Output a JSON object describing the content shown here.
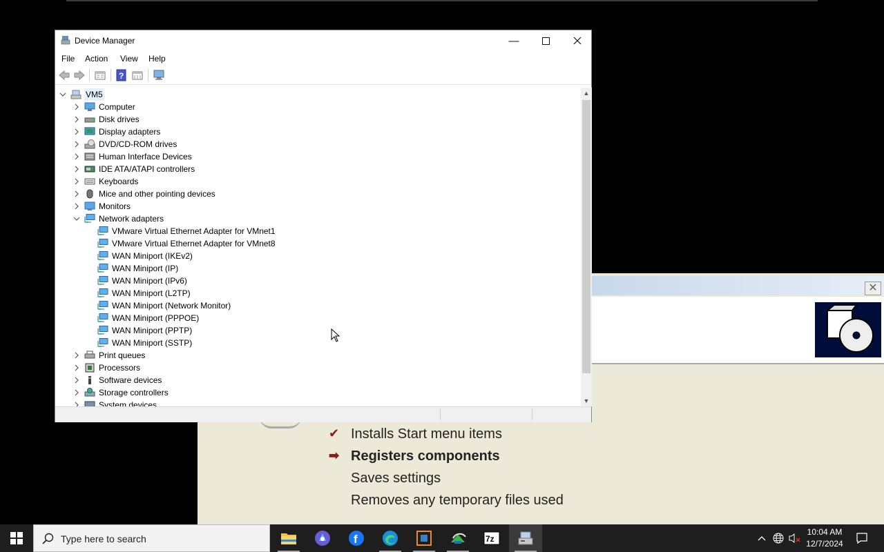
{
  "device_manager": {
    "title": "Device Manager",
    "menu": [
      "File",
      "Action",
      "View",
      "Help"
    ],
    "root": "VM5",
    "tree": [
      {
        "label": "Computer",
        "icon": "computer-icon",
        "expanded": false
      },
      {
        "label": "Disk drives",
        "icon": "disk-icon",
        "expanded": false
      },
      {
        "label": "Display adapters",
        "icon": "display-adapter-icon",
        "expanded": false
      },
      {
        "label": "DVD/CD-ROM drives",
        "icon": "dvd-icon",
        "expanded": false
      },
      {
        "label": "Human Interface Devices",
        "icon": "hid-icon",
        "expanded": false
      },
      {
        "label": "IDE ATA/ATAPI controllers",
        "icon": "ide-icon",
        "expanded": false
      },
      {
        "label": "Keyboards",
        "icon": "keyboard-icon",
        "expanded": false
      },
      {
        "label": "Mice and other pointing devices",
        "icon": "mouse-icon",
        "expanded": false
      },
      {
        "label": "Monitors",
        "icon": "monitor-icon",
        "expanded": false
      },
      {
        "label": "Network adapters",
        "icon": "network-icon",
        "expanded": true,
        "children": [
          "VMware Virtual Ethernet Adapter for VMnet1",
          "VMware Virtual Ethernet Adapter for VMnet8",
          "WAN Miniport (IKEv2)",
          "WAN Miniport (IP)",
          "WAN Miniport (IPv6)",
          "WAN Miniport (L2TP)",
          "WAN Miniport (Network Monitor)",
          "WAN Miniport (PPPOE)",
          "WAN Miniport (PPTP)",
          "WAN Miniport (SSTP)"
        ]
      },
      {
        "label": "Print queues",
        "icon": "printer-icon",
        "expanded": false
      },
      {
        "label": "Processors",
        "icon": "processor-icon",
        "expanded": false
      },
      {
        "label": "Software devices",
        "icon": "software-device-icon",
        "expanded": false
      },
      {
        "label": "Storage controllers",
        "icon": "storage-icon",
        "expanded": false
      },
      {
        "label": "System devices",
        "icon": "system-icon",
        "expanded": false
      }
    ]
  },
  "installer": {
    "steps": [
      {
        "text": "Installs Start menu items",
        "mark": "✔",
        "bold": false
      },
      {
        "text": "Registers components",
        "mark": "➡",
        "bold": true
      },
      {
        "text": "Saves settings",
        "mark": "",
        "bold": false
      },
      {
        "text": "Removes any temporary files used",
        "mark": "",
        "bold": false
      }
    ]
  },
  "taskbar": {
    "search_placeholder": "Type here to search",
    "apps": [
      "file-explorer-icon",
      "copilot-icon",
      "firefox-icon",
      "edge-icon",
      "virtualbox-icon",
      "setup-icon",
      "7zip-icon",
      "device-manager-icon"
    ],
    "time": "10:04 AM",
    "date": "12/7/2024"
  }
}
